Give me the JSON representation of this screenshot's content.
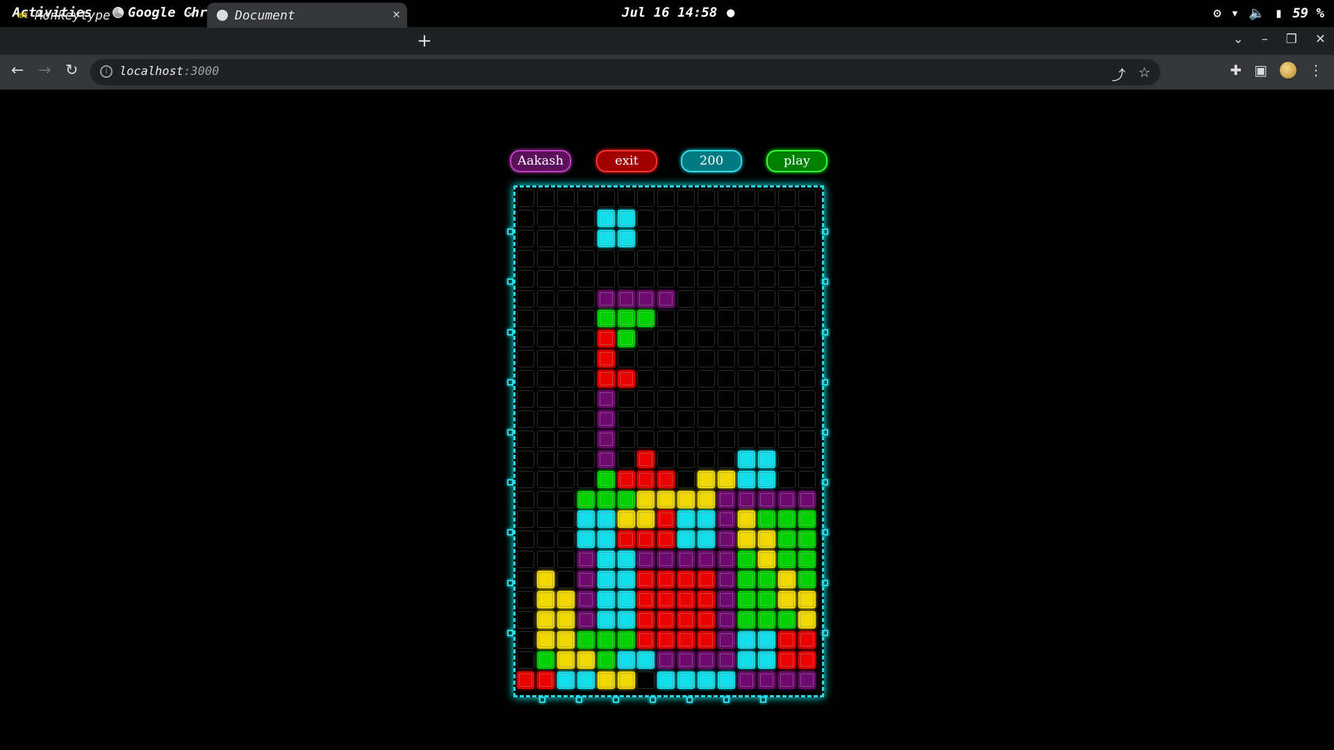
{
  "system_bar": {
    "activities": "Activities",
    "app_name": "Google Chrome",
    "clock": "Jul 16  14:58",
    "battery": "59 %"
  },
  "tabs": [
    {
      "label": "Monkeytype",
      "favicon": "mt"
    },
    {
      "label": "Document"
    }
  ],
  "address_bar": {
    "host": "localhost",
    "port": ":3000"
  },
  "game": {
    "player_name": "Aakash",
    "exit_label": "exit",
    "score": "200",
    "play_label": "play",
    "palette": {
      "C": "#0fd5e0",
      "M": "#6a0a6a",
      "G": "#00c800",
      "R": "#e00000",
      "Y": "#e6d000"
    },
    "board": [
      "...............",
      "....CC.........",
      "....CC.........",
      "...............",
      "...............",
      "....MMMM.......",
      "....GGG........",
      "....RG.........",
      "....R..........",
      "....RR.........",
      "....M..........",
      "....M..........",
      "....M..........",
      "....M.R....CC..",
      "....GRRR.YYCC..",
      "...GGGYYYYMMMMM",
      "...CCYYRCCMYGGG",
      "...CCRRRCCMYYGG",
      "...MCCMMMMMGYGG",
      ".Y.MCCRRRRMGGYG",
      ".YYMCCRRRRMGGYY",
      ".YYMCCRRRRMGGGY",
      ".YYGGGRRRRMCCRR",
      ".GYYGCCMMMMCCRR",
      "RRCCYY.CCCCMMMM"
    ]
  }
}
